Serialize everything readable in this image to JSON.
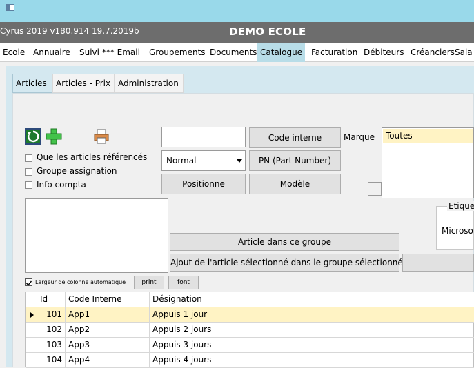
{
  "header": {
    "version": "Cyrus 2019 v180.914 19.7.2019b",
    "school": "DEMO ECOLE"
  },
  "menu": [
    {
      "label": "Ecole",
      "active": false
    },
    {
      "label": "Annuaire",
      "active": false
    },
    {
      "label": "Suivi *** Email",
      "active": false
    },
    {
      "label": "Groupements",
      "active": false
    },
    {
      "label": "Documents",
      "active": false
    },
    {
      "label": "Catalogue",
      "active": true
    },
    {
      "label": "Facturation",
      "active": false
    },
    {
      "label": "Débiteurs",
      "active": false
    },
    {
      "label": "Créanciers",
      "active": false
    },
    {
      "label": "Sala",
      "active": false
    }
  ],
  "tabs": [
    {
      "label": "Articles",
      "active": true
    },
    {
      "label": "Articles - Prix",
      "active": false
    },
    {
      "label": "Administration",
      "active": false
    }
  ],
  "checks": [
    {
      "label": "Que les articles référencés",
      "checked": false
    },
    {
      "label": "Groupe assignation",
      "checked": false
    },
    {
      "label": "Info compta",
      "checked": false
    }
  ],
  "search": {
    "value": "",
    "dropdown_value": "Normal"
  },
  "buttons": {
    "code_interne": "Code interne",
    "pn": "PN (Part Number)",
    "positionne": "Positionne",
    "modele": "Modèle",
    "article_groupe": "Article dans ce groupe",
    "ajout": "Ajout de l'article sélectionné dans le groupe sélectionné",
    "print": "print",
    "font": "font"
  },
  "marque": {
    "label": "Marque",
    "selected": "Toutes"
  },
  "etiquette": {
    "label": "Etiquet",
    "value": "Microso"
  },
  "auto_width_label": "Largeur de colonne automatique",
  "grid": {
    "columns": [
      "Id",
      "Code Interne",
      "Désignation"
    ],
    "rows": [
      {
        "id": "101",
        "code": "App1",
        "designation": "Appuis 1 jour",
        "selected": true
      },
      {
        "id": "102",
        "code": "App2",
        "designation": "Appuis 2 jours",
        "selected": false
      },
      {
        "id": "103",
        "code": "App3",
        "designation": "Appuis 3 jours",
        "selected": false
      },
      {
        "id": "104",
        "code": "App4",
        "designation": "Appuis 4 jours",
        "selected": false
      }
    ]
  },
  "colors": {
    "title_bar": "#99d9ea",
    "header_bar": "#6d6d6d",
    "active_tab": "#b8dde8",
    "selected_row": "#fff3c4"
  },
  "icons": [
    "window-icon",
    "refresh-icon",
    "add-icon",
    "print-icon",
    "dropdown-arrow-icon",
    "row-pointer-icon",
    "check-icon"
  ]
}
